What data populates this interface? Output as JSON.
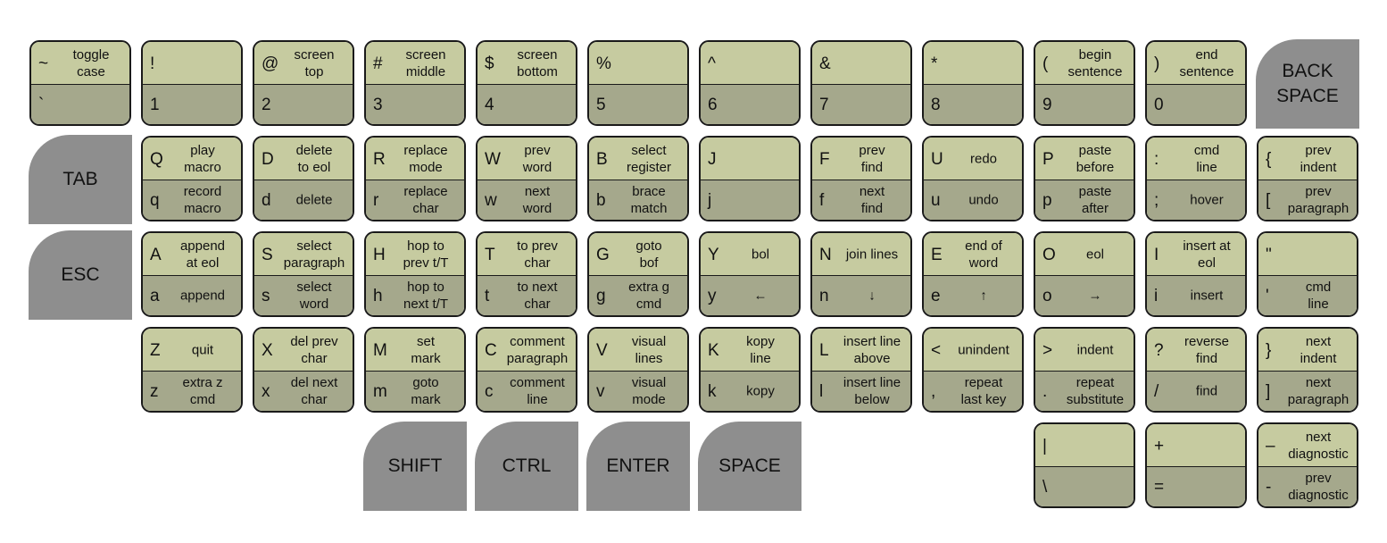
{
  "colors": {
    "top_face": "#c6cba0",
    "bottom_face": "#a5a88c",
    "modifier": "#8e8e8e",
    "border": "#1a1a1a"
  },
  "keys": [
    {
      "id": "tilde",
      "row": 0,
      "col": 0,
      "top": {
        "char": "~",
        "desc": "toggle\ncase"
      },
      "bottom": {
        "char": "`",
        "desc": ""
      }
    },
    {
      "id": "1",
      "row": 0,
      "col": 1,
      "top": {
        "char": "!",
        "desc": ""
      },
      "bottom": {
        "char": "1",
        "desc": ""
      }
    },
    {
      "id": "2",
      "row": 0,
      "col": 2,
      "top": {
        "char": "@",
        "desc": "screen\ntop"
      },
      "bottom": {
        "char": "2",
        "desc": ""
      }
    },
    {
      "id": "3",
      "row": 0,
      "col": 3,
      "top": {
        "char": "#",
        "desc": "screen\nmiddle"
      },
      "bottom": {
        "char": "3",
        "desc": ""
      }
    },
    {
      "id": "4",
      "row": 0,
      "col": 4,
      "top": {
        "char": "$",
        "desc": "screen\nbottom"
      },
      "bottom": {
        "char": "4",
        "desc": ""
      }
    },
    {
      "id": "5",
      "row": 0,
      "col": 5,
      "top": {
        "char": "%",
        "desc": ""
      },
      "bottom": {
        "char": "5",
        "desc": ""
      }
    },
    {
      "id": "6",
      "row": 0,
      "col": 6,
      "top": {
        "char": "^",
        "desc": ""
      },
      "bottom": {
        "char": "6",
        "desc": ""
      }
    },
    {
      "id": "7",
      "row": 0,
      "col": 7,
      "top": {
        "char": "&",
        "desc": ""
      },
      "bottom": {
        "char": "7",
        "desc": ""
      }
    },
    {
      "id": "8",
      "row": 0,
      "col": 8,
      "top": {
        "char": "*",
        "desc": ""
      },
      "bottom": {
        "char": "8",
        "desc": ""
      }
    },
    {
      "id": "9",
      "row": 0,
      "col": 9,
      "top": {
        "char": "(",
        "desc": "begin\nsentence"
      },
      "bottom": {
        "char": "9",
        "desc": ""
      }
    },
    {
      "id": "0",
      "row": 0,
      "col": 10,
      "top": {
        "char": ")",
        "desc": "end\nsentence"
      },
      "bottom": {
        "char": "0",
        "desc": ""
      }
    },
    {
      "id": "q",
      "row": 1,
      "col": 1,
      "top": {
        "char": "Q",
        "desc": "play\nmacro"
      },
      "bottom": {
        "char": "q",
        "desc": "record\nmacro"
      }
    },
    {
      "id": "d",
      "row": 1,
      "col": 2,
      "top": {
        "char": "D",
        "desc": "delete\nto eol"
      },
      "bottom": {
        "char": "d",
        "desc": "delete"
      }
    },
    {
      "id": "r",
      "row": 1,
      "col": 3,
      "top": {
        "char": "R",
        "desc": "replace\nmode"
      },
      "bottom": {
        "char": "r",
        "desc": "replace\nchar"
      }
    },
    {
      "id": "w",
      "row": 1,
      "col": 4,
      "top": {
        "char": "W",
        "desc": "prev\nword"
      },
      "bottom": {
        "char": "w",
        "desc": "next\nword"
      }
    },
    {
      "id": "b",
      "row": 1,
      "col": 5,
      "top": {
        "char": "B",
        "desc": "select\nregister"
      },
      "bottom": {
        "char": "b",
        "desc": "brace\nmatch"
      }
    },
    {
      "id": "j",
      "row": 1,
      "col": 6,
      "top": {
        "char": "J",
        "desc": ""
      },
      "bottom": {
        "char": "j",
        "desc": ""
      }
    },
    {
      "id": "f",
      "row": 1,
      "col": 7,
      "top": {
        "char": "F",
        "desc": "prev\nfind"
      },
      "bottom": {
        "char": "f",
        "desc": "next\nfind"
      }
    },
    {
      "id": "u",
      "row": 1,
      "col": 8,
      "top": {
        "char": "U",
        "desc": "redo"
      },
      "bottom": {
        "char": "u",
        "desc": "undo"
      }
    },
    {
      "id": "p",
      "row": 1,
      "col": 9,
      "top": {
        "char": "P",
        "desc": "paste\nbefore"
      },
      "bottom": {
        "char": "p",
        "desc": "paste\nafter"
      }
    },
    {
      "id": "semicolon",
      "row": 1,
      "col": 10,
      "top": {
        "char": ":",
        "desc": "cmd\nline"
      },
      "bottom": {
        "char": ";",
        "desc": "hover"
      }
    },
    {
      "id": "bracket-left",
      "row": 1,
      "col": 11,
      "top": {
        "char": "{",
        "desc": "prev\nindent"
      },
      "bottom": {
        "char": "[",
        "desc": "prev\nparagraph"
      }
    },
    {
      "id": "a",
      "row": 2,
      "col": 1,
      "top": {
        "char": "A",
        "desc": "append\nat eol"
      },
      "bottom": {
        "char": "a",
        "desc": "append"
      }
    },
    {
      "id": "s",
      "row": 2,
      "col": 2,
      "top": {
        "char": "S",
        "desc": "select\nparagraph"
      },
      "bottom": {
        "char": "s",
        "desc": "select\nword"
      }
    },
    {
      "id": "h",
      "row": 2,
      "col": 3,
      "top": {
        "char": "H",
        "desc": "hop to\nprev t/T"
      },
      "bottom": {
        "char": "h",
        "desc": "hop to\nnext t/T"
      }
    },
    {
      "id": "t",
      "row": 2,
      "col": 4,
      "top": {
        "char": "T",
        "desc": "to prev\nchar"
      },
      "bottom": {
        "char": "t",
        "desc": "to next\nchar"
      }
    },
    {
      "id": "g",
      "row": 2,
      "col": 5,
      "top": {
        "char": "G",
        "desc": "goto\nbof"
      },
      "bottom": {
        "char": "g",
        "desc": "extra g\ncmd"
      }
    },
    {
      "id": "y",
      "row": 2,
      "col": 6,
      "top": {
        "char": "Y",
        "desc": "bol"
      },
      "bottom": {
        "char": "y",
        "desc": "←"
      }
    },
    {
      "id": "n",
      "row": 2,
      "col": 7,
      "top": {
        "char": "N",
        "desc": "join lines"
      },
      "bottom": {
        "char": "n",
        "desc": "↓"
      }
    },
    {
      "id": "e",
      "row": 2,
      "col": 8,
      "top": {
        "char": "E",
        "desc": "end of\nword"
      },
      "bottom": {
        "char": "e",
        "desc": "↑"
      }
    },
    {
      "id": "o",
      "row": 2,
      "col": 9,
      "top": {
        "char": "O",
        "desc": "eol"
      },
      "bottom": {
        "char": "o",
        "desc": "→"
      }
    },
    {
      "id": "i",
      "row": 2,
      "col": 10,
      "top": {
        "char": "I",
        "desc": "insert at\neol"
      },
      "bottom": {
        "char": "i",
        "desc": "insert"
      }
    },
    {
      "id": "quote",
      "row": 2,
      "col": 11,
      "top": {
        "char": "\"",
        "desc": ""
      },
      "bottom": {
        "char": "'",
        "desc": "cmd\nline"
      }
    },
    {
      "id": "z",
      "row": 3,
      "col": 1,
      "top": {
        "char": "Z",
        "desc": "quit"
      },
      "bottom": {
        "char": "z",
        "desc": "extra z\ncmd"
      }
    },
    {
      "id": "x",
      "row": 3,
      "col": 2,
      "top": {
        "char": "X",
        "desc": "del prev\nchar"
      },
      "bottom": {
        "char": "x",
        "desc": "del next\nchar"
      }
    },
    {
      "id": "m",
      "row": 3,
      "col": 3,
      "top": {
        "char": "M",
        "desc": "set\nmark"
      },
      "bottom": {
        "char": "m",
        "desc": "goto\nmark"
      }
    },
    {
      "id": "c",
      "row": 3,
      "col": 4,
      "top": {
        "char": "C",
        "desc": "comment\nparagraph"
      },
      "bottom": {
        "char": "c",
        "desc": "comment\nline"
      }
    },
    {
      "id": "v",
      "row": 3,
      "col": 5,
      "top": {
        "char": "V",
        "desc": "visual\nlines"
      },
      "bottom": {
        "char": "v",
        "desc": "visual\nmode"
      }
    },
    {
      "id": "k",
      "row": 3,
      "col": 6,
      "top": {
        "char": "K",
        "desc": "kopy\nline"
      },
      "bottom": {
        "char": "k",
        "desc": "kopy"
      }
    },
    {
      "id": "l",
      "row": 3,
      "col": 7,
      "top": {
        "char": "L",
        "desc": "insert line\nabove"
      },
      "bottom": {
        "char": "l",
        "desc": "insert line\nbelow"
      }
    },
    {
      "id": "comma",
      "row": 3,
      "col": 8,
      "top": {
        "char": "<",
        "desc": "unindent"
      },
      "bottom": {
        "char": ",",
        "desc": "repeat\nlast key"
      }
    },
    {
      "id": "period",
      "row": 3,
      "col": 9,
      "top": {
        "char": ">",
        "desc": "indent"
      },
      "bottom": {
        "char": ".",
        "desc": "repeat\nsubstitute"
      }
    },
    {
      "id": "slash",
      "row": 3,
      "col": 10,
      "top": {
        "char": "?",
        "desc": "reverse\nfind"
      },
      "bottom": {
        "char": "/",
        "desc": "find"
      }
    },
    {
      "id": "bracket-right",
      "row": 3,
      "col": 11,
      "top": {
        "char": "}",
        "desc": "next\nindent"
      },
      "bottom": {
        "char": "]",
        "desc": "next\nparagraph"
      }
    },
    {
      "id": "backslash",
      "row": 4,
      "col": 9,
      "top": {
        "char": "|",
        "desc": ""
      },
      "bottom": {
        "char": "\\",
        "desc": ""
      }
    },
    {
      "id": "equals",
      "row": 4,
      "col": 10,
      "top": {
        "char": "+",
        "desc": ""
      },
      "bottom": {
        "char": "=",
        "desc": ""
      }
    },
    {
      "id": "minus",
      "row": 4,
      "col": 11,
      "top": {
        "char": "–",
        "desc": "next\ndiagnostic"
      },
      "bottom": {
        "char": "-",
        "desc": "prev\ndiagnostic"
      }
    }
  ],
  "modifiers": [
    {
      "id": "backspace",
      "row": 0,
      "col": 11,
      "label": "BACK\nSPACE"
    },
    {
      "id": "tab",
      "row": 1,
      "col": 0,
      "label": "TAB"
    },
    {
      "id": "esc",
      "row": 2,
      "col": 0,
      "label": "ESC"
    },
    {
      "id": "shift",
      "row": 4,
      "col": 3,
      "label": "SHIFT"
    },
    {
      "id": "ctrl",
      "row": 4,
      "col": 4,
      "label": "CTRL"
    },
    {
      "id": "enter",
      "row": 4,
      "col": 5,
      "label": "ENTER"
    },
    {
      "id": "space",
      "row": 4,
      "col": 6,
      "label": "SPACE"
    }
  ]
}
